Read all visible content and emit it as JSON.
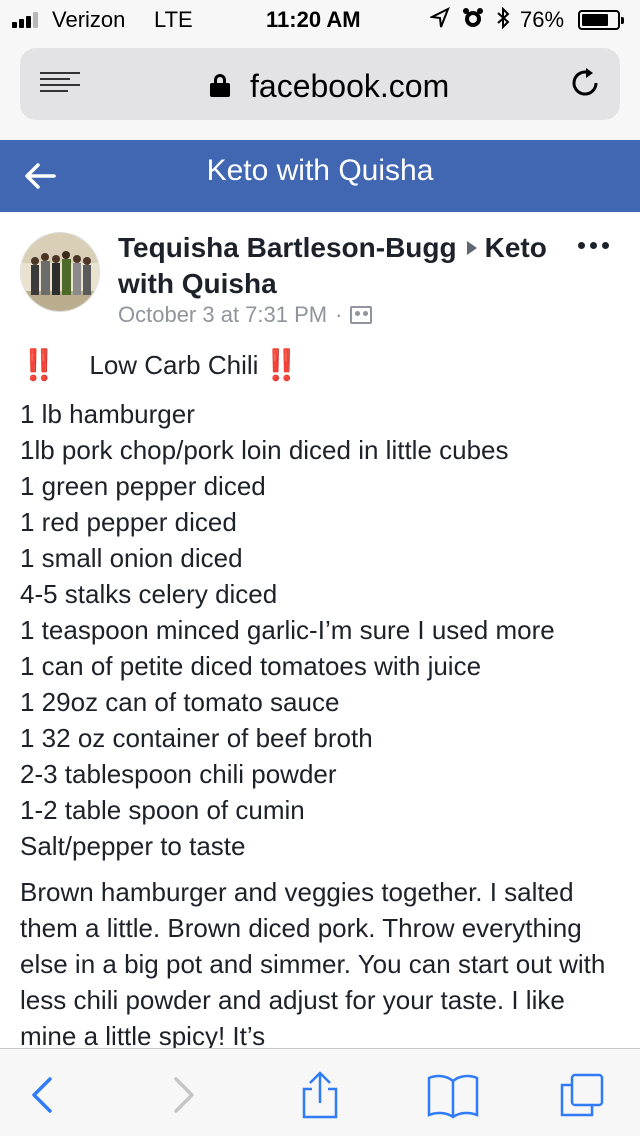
{
  "status_bar": {
    "carrier": "Verizon",
    "network": "LTE",
    "time": "11:20 AM",
    "battery_percent": "76%",
    "battery_level": 0.76,
    "icons": [
      "location-arrow-icon",
      "alarm-icon",
      "bluetooth-icon"
    ]
  },
  "browser": {
    "url": "facebook.com",
    "icons": [
      "menu-icon",
      "lock-icon",
      "reload-icon"
    ]
  },
  "header": {
    "title": "Keto with Quisha",
    "back_icon": "back-arrow-icon"
  },
  "post": {
    "author": "Tequisha Bartleson-Bugg",
    "group": "Keto with Quisha",
    "timestamp": "October 3 at 7:31 PM",
    "separator": "·",
    "privacy_icon": "group-icon",
    "more_icon": "more-options-icon",
    "title": "Low Carb Chili",
    "title_emoji": "‼️",
    "ingredients": [
      "1 lb hamburger",
      "1lb pork chop/pork loin diced in little cubes",
      "1 green pepper diced",
      "1 red pepper diced",
      "1 small onion diced",
      "4-5 stalks celery diced",
      "1 teaspoon minced garlic-I’m sure I used more",
      "1 can of petite diced tomatoes with juice",
      "1 29oz can of tomato sauce",
      "1 32 oz container of beef broth",
      "2-3 tablespoon chili powder",
      "1-2 table spoon of cumin",
      "Salt/pepper to taste"
    ],
    "instructions": "Brown hamburger and veggies together. I salted them a little. Brown diced pork. Throw everything else in a big pot and simmer. You can start out with less chili powder and adjust for your taste. I like mine a little spicy! It’s"
  },
  "toolbar": {
    "icons": [
      "back-icon",
      "forward-icon",
      "share-icon",
      "bookmarks-icon",
      "tabs-icon"
    ],
    "accent": "#2f7cf6",
    "disabled": "#c4c4c6"
  },
  "colors": {
    "facebook_blue": "#4267b2",
    "emoji_red": "#e0242e",
    "meta_gray": "#90949c"
  }
}
